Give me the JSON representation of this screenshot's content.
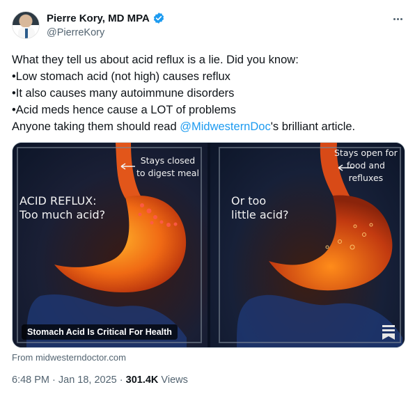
{
  "author": {
    "display_name": "Pierre Kory, MD MPA",
    "handle": "@PierreKory",
    "verified": true
  },
  "tweet": {
    "lines": [
      "What they tell us about acid reflux is a lie. Did you know:",
      "•Low stomach acid (not high) causes reflux",
      "•It also causes many autoimmune disorders",
      "•Acid meds hence cause a LOT of problems"
    ],
    "last_line_prefix": "Anyone taking them should read ",
    "mention": "@MidwesternDoc",
    "last_line_suffix": "'s brilliant article."
  },
  "media": {
    "left_panel": {
      "headline_1": "ACID REFLUX:",
      "headline_2": "Too much acid?",
      "callout_1": "Stays closed",
      "callout_2": "to digest meal"
    },
    "right_panel": {
      "headline_1": "Or too",
      "headline_2": "little acid?",
      "callout_1": "Stays open for",
      "callout_2": "food and",
      "callout_3": "refluxes"
    },
    "caption": "Stomach Acid Is Critical For Health"
  },
  "source": "From midwesterndoctor.com",
  "meta": {
    "time": "6:48 PM",
    "separator": " · ",
    "date": "Jan 18, 2025",
    "views_count": "301.4K",
    "views_label": " Views"
  },
  "colors": {
    "link": "#1d9bf0",
    "muted": "#536471",
    "text": "#0f1419"
  },
  "icons": [
    "verified-badge-icon",
    "more-icon",
    "bookmark-icon"
  ]
}
